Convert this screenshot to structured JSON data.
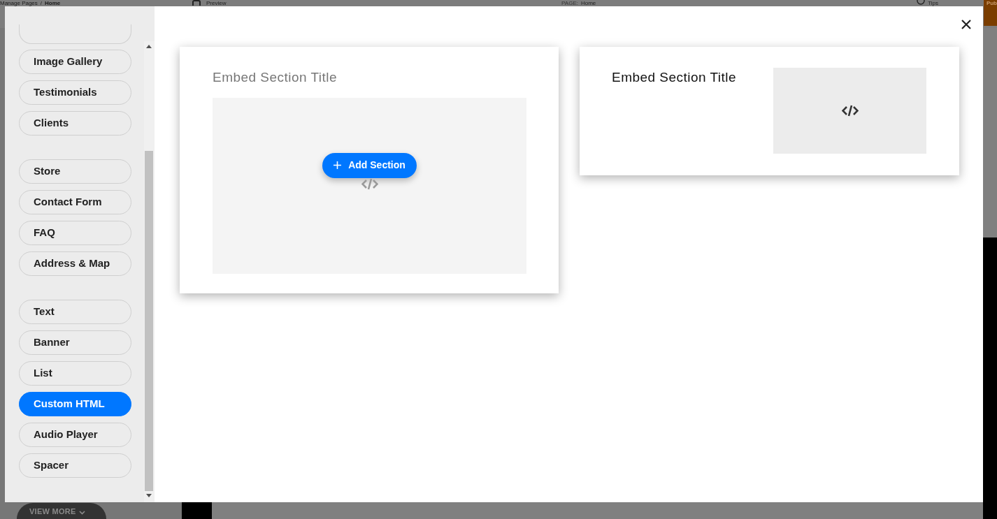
{
  "background": {
    "breadcrumb": [
      "Manage Pages",
      "/",
      "Home"
    ],
    "preview": "Preview",
    "page_label": "PAGE:",
    "page_value": "Home",
    "tips": "Tips",
    "publish": "Pub",
    "view_more": "VIEW MORE"
  },
  "sidebar": {
    "groups": [
      [
        {
          "label": "Image Gallery",
          "selected": false
        },
        {
          "label": "Testimonials",
          "selected": false
        },
        {
          "label": "Clients",
          "selected": false
        }
      ],
      [
        {
          "label": "Store",
          "selected": false
        },
        {
          "label": "Contact Form",
          "selected": false
        },
        {
          "label": "FAQ",
          "selected": false
        },
        {
          "label": "Address & Map",
          "selected": false
        }
      ],
      [
        {
          "label": "Text",
          "selected": false
        },
        {
          "label": "Banner",
          "selected": false
        },
        {
          "label": "List",
          "selected": false
        },
        {
          "label": "Custom HTML",
          "selected": true
        },
        {
          "label": "Audio Player",
          "selected": false
        },
        {
          "label": "Spacer",
          "selected": false
        }
      ]
    ]
  },
  "previews": [
    {
      "kind": "stacked",
      "title": "Embed Section Title",
      "button": "Add Section"
    },
    {
      "kind": "side",
      "title": "Embed Section Title"
    }
  ]
}
